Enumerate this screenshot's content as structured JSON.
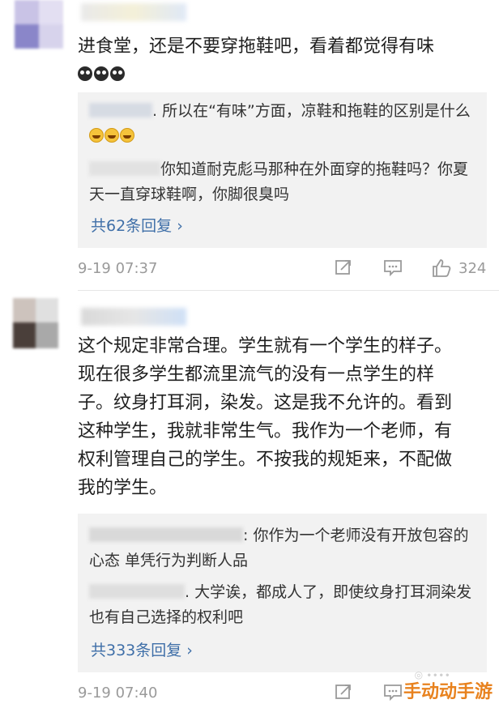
{
  "comments": [
    {
      "text": "进食堂，还是不要穿拖鞋吧，看着都觉得有味",
      "emojis": [
        "cry-icon",
        "cry-icon",
        "cry-icon"
      ],
      "replies": [
        {
          "text_pre": ". 所以在“有味”方面，凉鞋和拖鞋的区别是什么",
          "emojis": [
            "laugh-icon",
            "laugh-icon",
            "laugh-icon"
          ]
        },
        {
          "text_pre": "你知道耐克彪马那种在外面穿的拖鞋吗？你夏天一直穿球鞋啊，你脚很臭吗"
        }
      ],
      "reply_count": "共62条回复 ›",
      "time": "9-19 07:37",
      "likes": "324"
    },
    {
      "text": "这个规定非常合理。学生就有一个学生的样子。现在很多学生都流里流气的没有一点学生的样子。纹身打耳洞，染发。这是我不允许的。看到这种学生，我就非常生气。我作为一个老师，有权利管理自己的学生。不按我的规矩来，不配做我的学生。",
      "replies": [
        {
          "text_pre": ": 你作为一个老师没有开放包容的心态 单凭行为判断人品"
        },
        {
          "text_pre": ". 大学诶，都成人了，即使纹身打耳洞染发也有自己选择的权利吧"
        }
      ],
      "reply_count": "共333条回复 ›",
      "time": "9-19 07:40"
    }
  ],
  "watermark": "手动动手游",
  "colors": {
    "link": "#3f6fa8",
    "meta": "#9a9a9a",
    "reply_bg": "#f2f2f2"
  }
}
